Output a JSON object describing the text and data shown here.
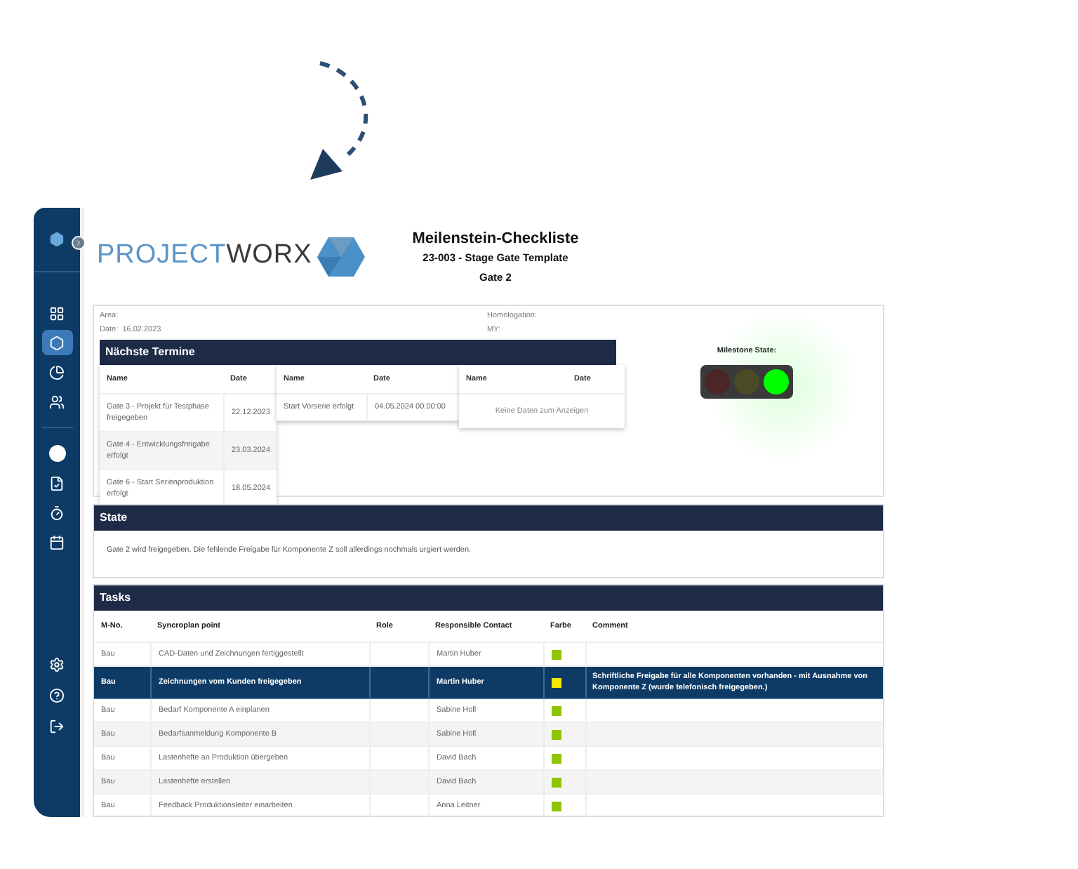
{
  "sidebar": {
    "items": [
      {
        "kind": "grid",
        "selected": false
      },
      {
        "kind": "hexagon",
        "selected": true
      },
      {
        "kind": "pie",
        "selected": false
      },
      {
        "kind": "users",
        "selected": false
      },
      {
        "kind": "avatar",
        "selected": false
      },
      {
        "kind": "document",
        "selected": false
      },
      {
        "kind": "timer",
        "selected": false
      },
      {
        "kind": "calendar",
        "selected": false
      }
    ]
  },
  "logo": {
    "part1": "PROJECT",
    "part2": "WORX"
  },
  "header": {
    "title": "Meilenstein-Checkliste",
    "subtitle": "23-003 - Stage Gate Template",
    "gate": "Gate 2"
  },
  "info": {
    "area": "Area:",
    "date": "Date:  16.02.2023",
    "homologation": "Homologation:",
    "my": "MY:"
  },
  "termine": {
    "title": "Nächste Termine",
    "tables": [
      {
        "columns": [
          "Name",
          "Date"
        ],
        "rows": [
          [
            "Gate 3 - Projekt für Testphase freigegeben",
            "22.12.2023"
          ],
          [
            "Gate 4 - Entwicklungsfreigabe erfolgt",
            "23.03.2024"
          ],
          [
            "Gate 6 - Start Serienproduktion erfolgt",
            "18.05.2024"
          ]
        ]
      },
      {
        "columns": [
          "Name",
          "Date"
        ],
        "rows": [
          [
            "Start Vorserie erfolgt",
            "04.05.2024 00:00:00"
          ]
        ]
      },
      {
        "columns": [
          "Name",
          "Date"
        ],
        "empty": "Keine Daten zum Anzeigen"
      }
    ]
  },
  "milestone": {
    "label": "Milestone State:",
    "lights": [
      {
        "on": false
      },
      {
        "on": false
      },
      {
        "on": true
      }
    ]
  },
  "state": {
    "title": "State",
    "text": "Gate 2 wird freigegeben. Die fehlende Freigabe für Komponente Z soll allerdings nochmals urgiert werden."
  },
  "tasks": {
    "title": "Tasks",
    "columns": [
      "M-No.",
      "Syncroplan point",
      "Role",
      "Responsible Contact",
      "Farbe",
      "Comment"
    ],
    "rows": [
      {
        "m_no": "Bau",
        "point": "CAD-Daten und Zeichnungen fertiggestellt",
        "contact": "Martin Huber",
        "color": "#8fc400",
        "selected": false
      },
      {
        "m_no": "Bau",
        "point": "Zeichnungen vom Kunden freigegeben",
        "contact": "Martin Huber",
        "color": "#f5e700",
        "comment": "Schriftliche Freigabe für alle Komponenten vorhanden - mit Ausnahme von Komponente Z (wurde telefonisch freigegeben.)",
        "selected": true
      },
      {
        "m_no": "Bau",
        "point": "Bedarf Komponente A einplanen",
        "contact": "Sabine Holl",
        "color": "#8fc400",
        "selected": false
      },
      {
        "m_no": "Bau",
        "point": "Bedarfsanmeldung Komponente B",
        "contact": "Sabine Holl",
        "color": "#8fc400",
        "selected": false
      },
      {
        "m_no": "Bau",
        "point": "Lastenhefte an Produktion übergeben",
        "contact": "David Bach",
        "color": "#8fc400",
        "selected": false
      },
      {
        "m_no": "Bau",
        "point": "Lastenhefte erstellen",
        "contact": "David Bach",
        "color": "#8fc400",
        "selected": false
      },
      {
        "m_no": "Bau",
        "point": "Feedback Produktionsleiter einarbeiten",
        "contact": "Anna Leitner",
        "color": "#8fc400",
        "selected": false
      }
    ]
  }
}
